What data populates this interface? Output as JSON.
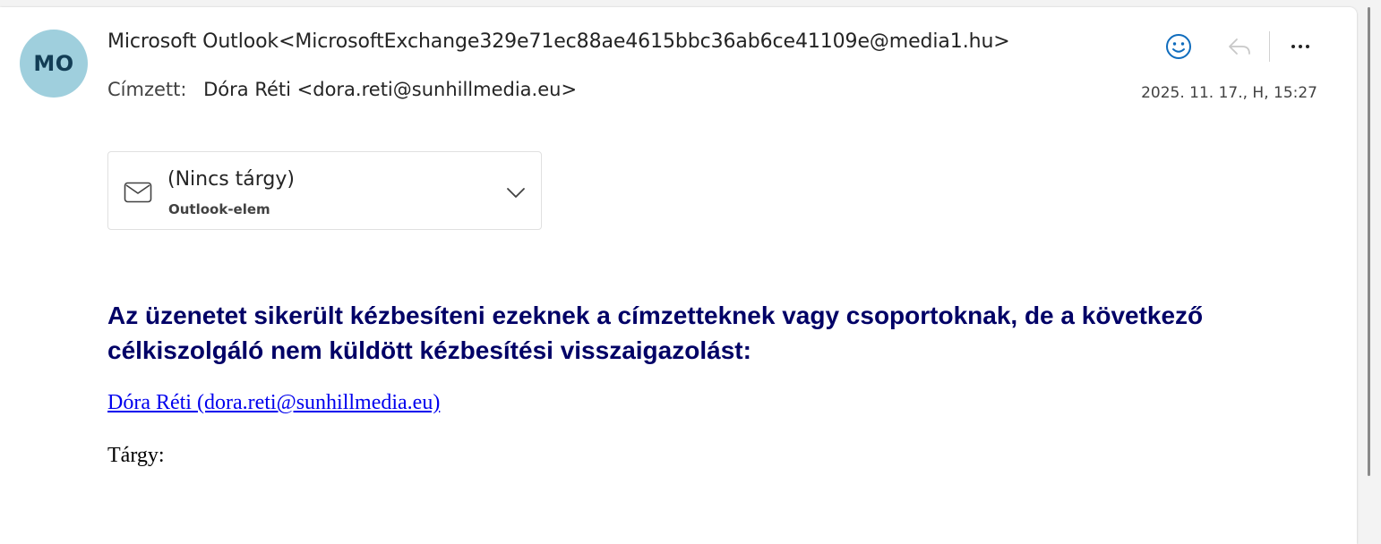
{
  "header": {
    "avatar_initials": "MO",
    "from": "Microsoft Outlook<MicrosoftExchange329e71ec88ae4615bbc36ab6ce41109e@media1.hu>",
    "to_label": "Címzett:",
    "to_value": "Dóra Réti <dora.reti@sunhillmedia.eu>",
    "date": "2025. 11. 17., H, 15:27"
  },
  "actions": {
    "react_icon": "smiley-icon",
    "reply_icon": "reply-icon",
    "more_icon": "more-icon"
  },
  "attachment": {
    "name": "(Nincs tárgy)",
    "type": "Outlook-elem",
    "icon": "envelope-icon"
  },
  "body": {
    "heading": "Az üzenetet sikerült kézbesíteni ezeknek a címzetteknek vagy csoportoknak, de a következő célkiszolgáló nem küldött kézbesítési visszaigazolást:",
    "recipient_link": "Dóra Réti (dora.reti@sunhillmedia.eu)",
    "subject_label": "Tárgy:"
  },
  "colors": {
    "avatar_bg": "#9fcfdd",
    "accent": "#0f6cbd",
    "heading": "#000066",
    "link": "#0000ee"
  }
}
